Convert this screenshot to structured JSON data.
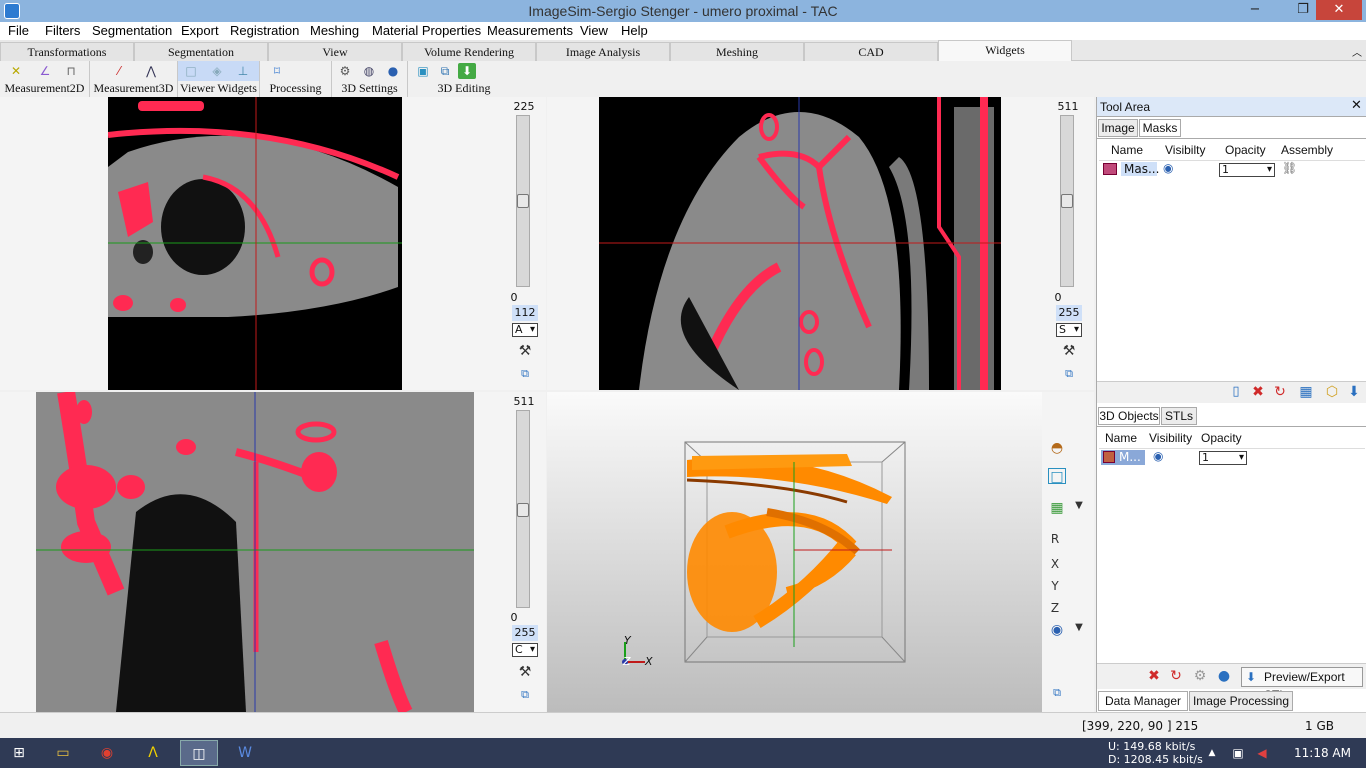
{
  "window": {
    "title": "ImageSim-Sergio Stenger - umero proximal - TAC",
    "min": "−",
    "restore": "❐",
    "close": "✕"
  },
  "menu": [
    "File",
    "Filters",
    "Segmentation",
    "Export",
    "Registration",
    "Meshing",
    "Material Properties",
    "Measurements",
    "View",
    "Help"
  ],
  "tabs": [
    "Transformations",
    "Segmentation",
    "View",
    "Volume Rendering",
    "Image Analysis",
    "Meshing",
    "CAD",
    "Widgets"
  ],
  "active_tab": "Widgets",
  "ribbon_groups": [
    "Measurement2D",
    "Measurement3D",
    "Viewer Widgets",
    "Processing",
    "3D Settings",
    "3D Editing"
  ],
  "views": {
    "axial": {
      "max": "225",
      "min": "0",
      "slice": "112",
      "orient": "A"
    },
    "sagittal": {
      "max": "511",
      "min": "0",
      "slice": "255",
      "orient": "S"
    },
    "coronal": {
      "max": "511",
      "min": "0",
      "slice": "255",
      "orient": "C"
    },
    "threed": {
      "axis_y": "Y",
      "axis_z": "Z",
      "axis_x": "X",
      "side_labels": [
        "R",
        "X",
        "Y",
        "Z"
      ]
    }
  },
  "toolarea": {
    "title": "Tool Area",
    "tabs": [
      "Image",
      "Masks"
    ],
    "headers": [
      "Name",
      "Visibilty",
      "Opacity",
      "Assembly"
    ],
    "row": {
      "name": "Mas...",
      "opacity": "1"
    },
    "tabs3d": [
      "3D Objects",
      "STLs"
    ],
    "headers3d": [
      "Name",
      "Visibility",
      "Opacity"
    ],
    "row3d": {
      "name": "M...",
      "opacity": "1"
    },
    "preview_button": "Preview/Export STL",
    "bottom_tabs": [
      "Data Manager",
      "Image Processing"
    ]
  },
  "status": {
    "coords": "[399, 220, 90 ] 215",
    "memory": "1 GB"
  },
  "taskbar": {
    "net_up": "U:    149.68 kbit/s",
    "net_down": "D:  1208.45 kbit/s",
    "time": "11:18 AM"
  },
  "colors": {
    "mask": "#ff2a52",
    "mesh": "#ff8a00"
  }
}
